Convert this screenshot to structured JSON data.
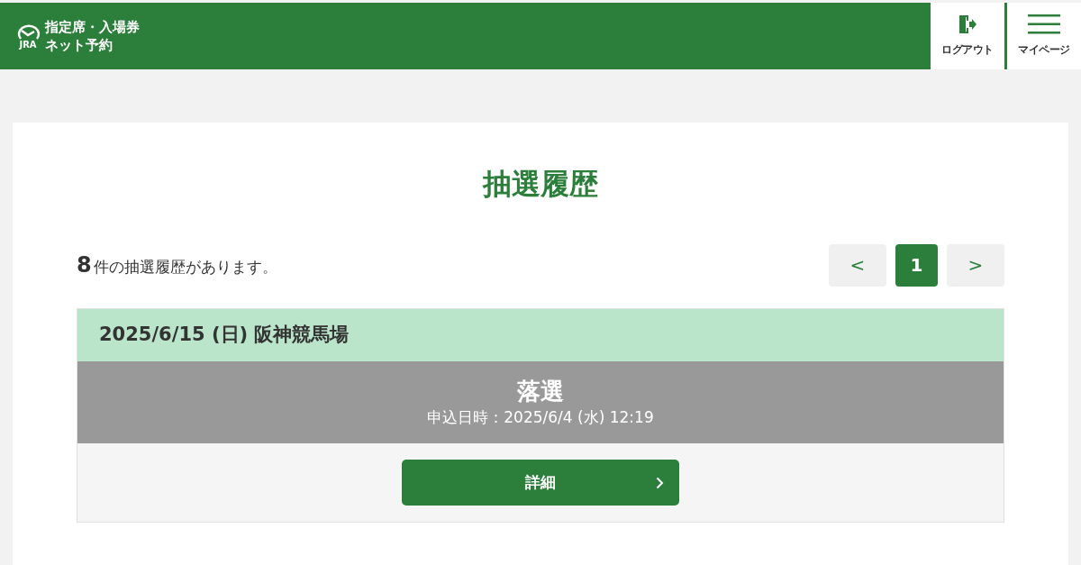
{
  "header": {
    "logo_text": "JRA",
    "title_lines": [
      "指定席・入場券",
      "ネット予約"
    ],
    "buttons": [
      {
        "kind": "logout",
        "label": "ログアウト"
      },
      {
        "kind": "menu",
        "label": "マイページ"
      }
    ]
  },
  "page_title": "抽選履歴",
  "summary": {
    "count": "8",
    "text": "件の抽選履歴があります。"
  },
  "pagination": [
    {
      "kind": "prev",
      "label": "<",
      "selected": false
    },
    {
      "kind": "page",
      "label": "1",
      "selected": true
    },
    {
      "kind": "next",
      "label": ">",
      "selected": false
    }
  ],
  "entries": [
    {
      "date": "2025/6/15 (日) 阪神競馬場",
      "result": "落選",
      "applied": "申込日時：2025/6/4 (水) 12:19",
      "button": "詳細"
    }
  ]
}
